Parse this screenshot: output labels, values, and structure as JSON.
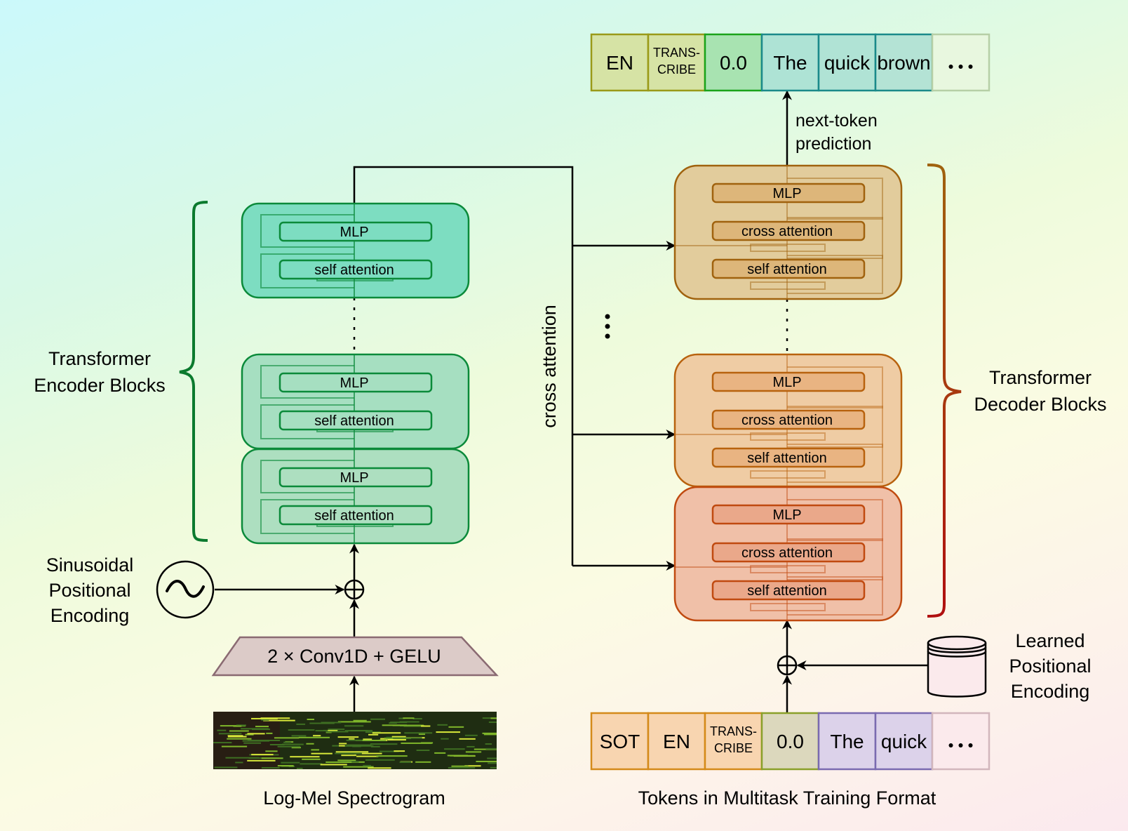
{
  "output_tokens": {
    "items": [
      {
        "label": "EN",
        "fill": "#d6e3a5",
        "stroke": "#9a9a18",
        "small": false
      },
      {
        "label": "TRANS-\nCRIBE",
        "fill": "#d6e3a5",
        "stroke": "#9a9a18",
        "small": true
      },
      {
        "label": "0.0",
        "fill": "#a8e3b1",
        "stroke": "#1aa31a",
        "small": false
      },
      {
        "label": "The",
        "fill": "#aee3d5",
        "stroke": "#1a8a8a",
        "small": false
      },
      {
        "label": "quick",
        "fill": "#b0e3d5",
        "stroke": "#1a8a8a",
        "small": false
      },
      {
        "label": "brown",
        "fill": "#b4e3d5",
        "stroke": "#1a8a8a",
        "small": false
      },
      {
        "label": "…",
        "fill": "#e8f7df",
        "stroke": "#b6cfa6",
        "small": false
      }
    ]
  },
  "input_tokens": {
    "caption": "Tokens in Multitask Training Format",
    "items": [
      {
        "label": "SOT",
        "fill": "#f8d5b0",
        "stroke": "#d48a1a",
        "small": false
      },
      {
        "label": "EN",
        "fill": "#f8d5b0",
        "stroke": "#d48a1a",
        "small": false
      },
      {
        "label": "TRANS-\nCRIBE",
        "fill": "#f8d5b0",
        "stroke": "#d48a1a",
        "small": true
      },
      {
        "label": "0.0",
        "fill": "#dcd8bd",
        "stroke": "#8aa02a",
        "small": false
      },
      {
        "label": "The",
        "fill": "#dcd2ea",
        "stroke": "#7a6ab0",
        "small": false
      },
      {
        "label": "quick",
        "fill": "#dcd2ea",
        "stroke": "#7a6ab0",
        "small": false
      },
      {
        "label": "…",
        "fill": "#fbeaec",
        "stroke": "#d2b6bc",
        "small": false
      }
    ]
  },
  "labels": {
    "next_token": [
      "next-token",
      "prediction"
    ],
    "cross_attention_vertical": "cross attention",
    "encoder_group": [
      "Transformer",
      "Encoder Blocks"
    ],
    "decoder_group": [
      "Transformer",
      "Decoder Blocks"
    ],
    "sinusoidal": [
      "Sinusoidal",
      "Positional",
      "Encoding"
    ],
    "learned": [
      "Learned",
      "Positional",
      "Encoding"
    ],
    "conv": "2 × Conv1D + GELU",
    "spectrogram_caption": "Log-Mel Spectrogram",
    "ellipsis": "⋮"
  },
  "encoder_blocks": [
    {
      "layers": [
        "MLP",
        "self attention"
      ],
      "fill": "#7dddc1"
    },
    {
      "layers": [
        "MLP",
        "self attention"
      ],
      "fill": "#a6dfc1"
    },
    {
      "layers": [
        "MLP",
        "self attention"
      ],
      "fill": "#addfc0"
    }
  ],
  "decoder_blocks": [
    {
      "layers": [
        "MLP",
        "cross attention",
        "self attention"
      ],
      "fill": "#e2cc9c",
      "stroke": "#a0620e",
      "inner": "#ddb67a"
    },
    {
      "layers": [
        "MLP",
        "cross attention",
        "self attention"
      ],
      "fill": "#efcca4",
      "stroke": "#b8620e",
      "inner": "#e9b482"
    },
    {
      "layers": [
        "MLP",
        "cross attention",
        "self attention"
      ],
      "fill": "#f0c0a8",
      "stroke": "#c04a10",
      "inner": "#eaa88a"
    }
  ],
  "colors": {
    "encoder_stroke": "#0b8a3a",
    "encoder_brace": "#0b7a2e",
    "decoder_brace_top": "#a0620e",
    "decoder_brace_bottom": "#b01010",
    "arrow": "#000000",
    "conv_fill": "#dccbc8",
    "conv_stroke": "#8a6a72"
  }
}
